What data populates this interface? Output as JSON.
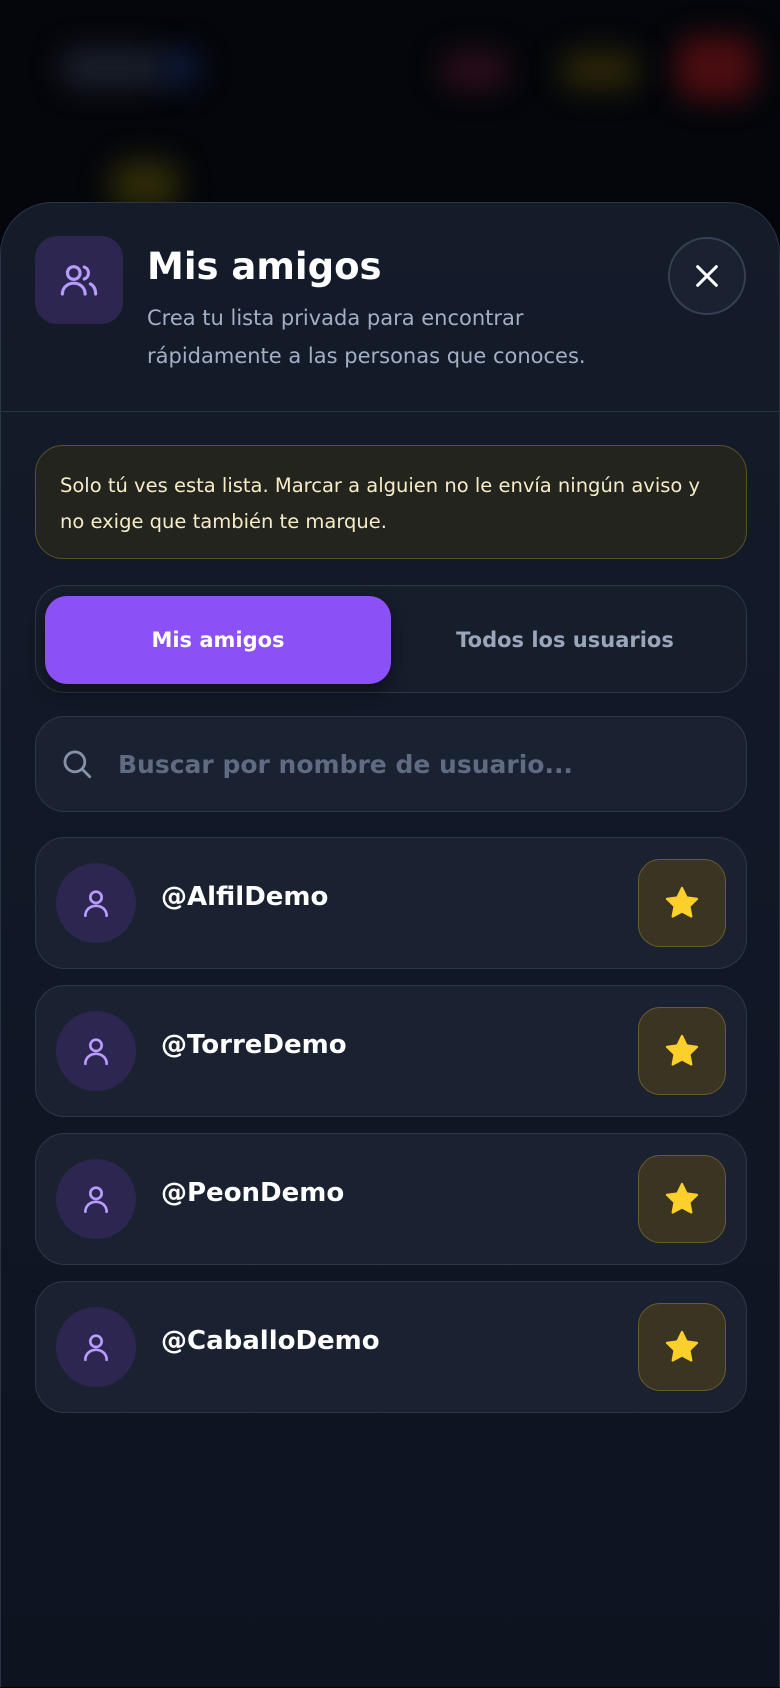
{
  "header": {
    "title": "Mis amigos",
    "subtitle": "Crea tu lista privada para encontrar rápidamente a las personas que conoces.",
    "icon": "users-icon",
    "close_icon": "close-icon"
  },
  "notice": {
    "text": "Solo tú ves esta lista. Marcar a alguien no le envía ningún aviso y no exige que también te marque."
  },
  "tabs": [
    {
      "label": "Mis amigos",
      "active": true
    },
    {
      "label": "Todos los usuarios",
      "active": false
    }
  ],
  "search": {
    "placeholder": "Buscar por nombre de usuario...",
    "value": ""
  },
  "friends": [
    {
      "username": "@AlfilDemo",
      "favorite": true
    },
    {
      "username": "@TorreDemo",
      "favorite": true
    },
    {
      "username": "@PeonDemo",
      "favorite": true
    },
    {
      "username": "@CaballoDemo",
      "favorite": true
    }
  ],
  "colors": {
    "accent": "#8b50f6",
    "star": "#fcd02b",
    "avatar_icon": "#b89bff"
  }
}
